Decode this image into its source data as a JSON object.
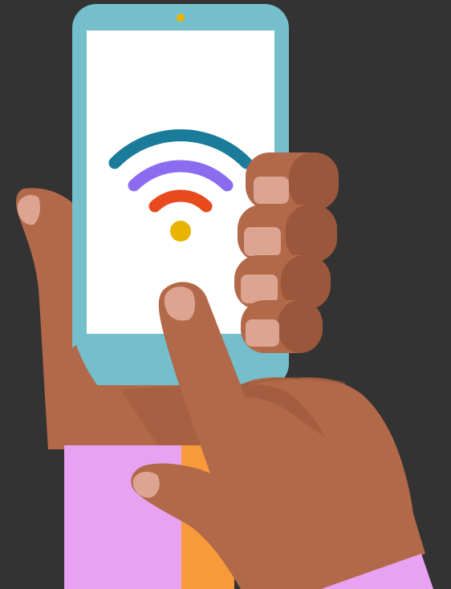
{
  "illustration": {
    "subject": "hand-holding-phone-wifi",
    "colors": {
      "background": "#333333",
      "phone_body": "#74BFCB",
      "phone_body_shadow": "#5FAAB6",
      "screen": "#FFFFFF",
      "camera": "#E8B400",
      "wifi_arc_outer": "#1A7C9A",
      "wifi_arc_middle": "#8B6CF0",
      "wifi_arc_inner": "#E84A1E",
      "wifi_dot": "#E8B400",
      "skin": "#B2694A",
      "skin_shadow": "#8E4F36",
      "skin_light": "#BE7656",
      "fingernail": "#DCA491",
      "sleeve_pink": "#E8A2F2",
      "sleeve_orange": "#F99A3A"
    },
    "icons": [
      "wifi-icon"
    ]
  }
}
